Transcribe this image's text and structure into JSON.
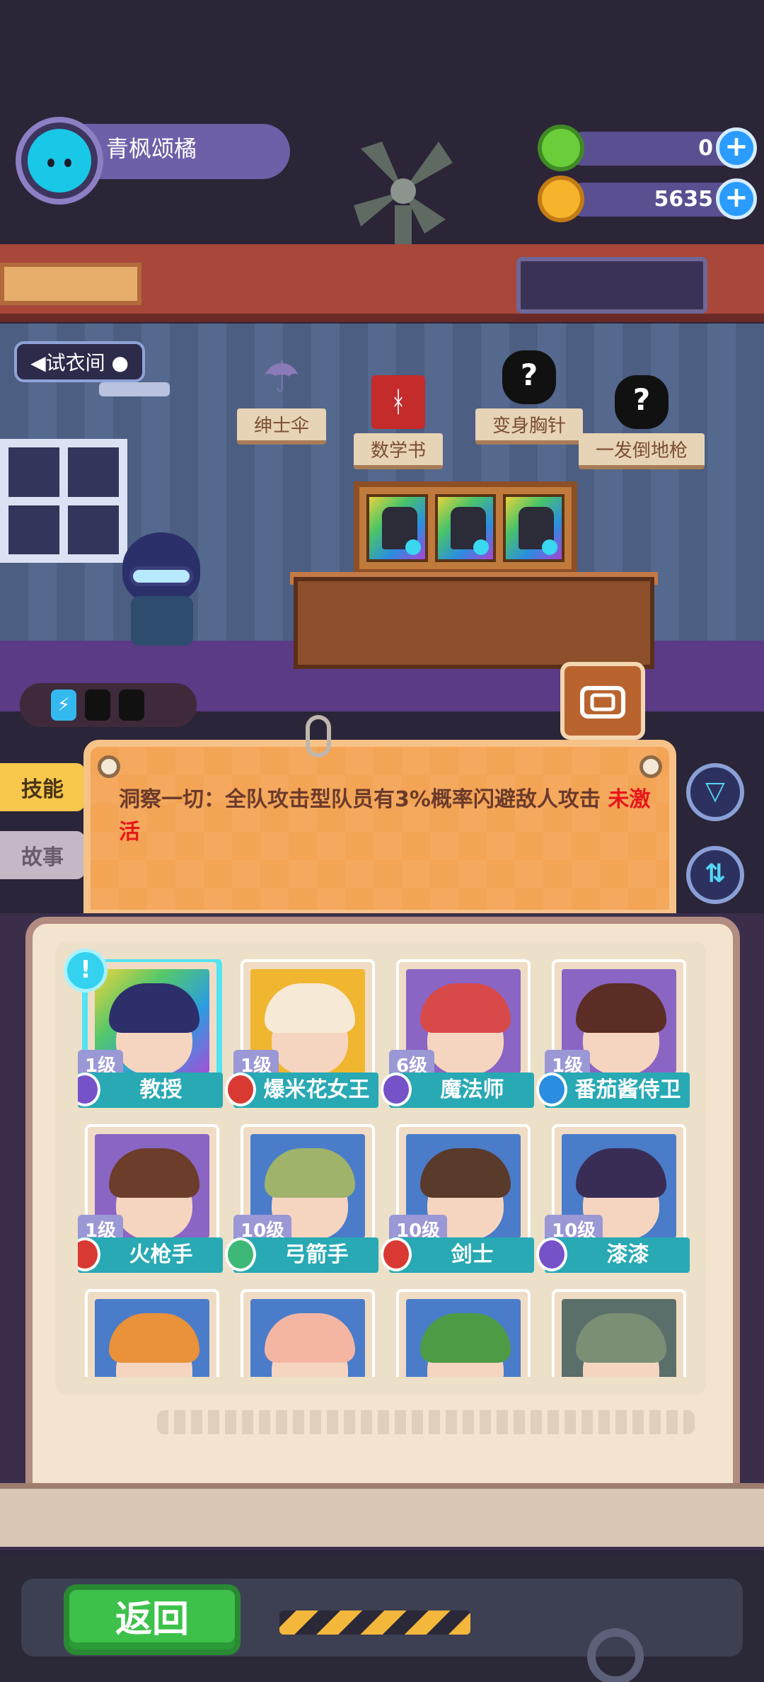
{
  "profile": {
    "name": "青枫颂橘"
  },
  "currencies": [
    {
      "value": "0",
      "icon": "green-gem-icon",
      "color": "#6ccd3a"
    },
    {
      "value": "5635",
      "icon": "gold-planet-coin-icon",
      "color": "#f5b42c"
    }
  ],
  "room": {
    "fitting_room_label": "◀试衣间 ●",
    "items": [
      {
        "label": "绅士伞",
        "icon": "umbrella-icon"
      },
      {
        "label": "数学书",
        "icon": "math-book-icon"
      },
      {
        "label": "变身胸针",
        "icon": "mystery-brooch-icon"
      },
      {
        "label": "一发倒地枪",
        "icon": "mystery-gun-icon"
      }
    ],
    "book_glyph": "ᚼ",
    "mystery_glyph": "?",
    "energy_glyph": "⚡"
  },
  "tabs": {
    "skill": "技能",
    "story": "故事"
  },
  "skill": {
    "text": "洞察一切：全队攻击型队员有3%概率闪避敌人攻击",
    "status": "未激活",
    "status_color": "#e6171b"
  },
  "buttons": {
    "filter": "▽",
    "sort": "⇅",
    "back": "返回",
    "plus": "+",
    "notice": "!"
  },
  "heroes": [
    {
      "level": "1级",
      "name": "教授",
      "faction": "purple",
      "bg": "rainbow",
      "hair": "#2d2f6b"
    },
    {
      "level": "1级",
      "name": "爆米花女王",
      "faction": "red",
      "bg": "#f1b630",
      "hair": "#f6ead6"
    },
    {
      "level": "6级",
      "name": "魔法师",
      "faction": "purple",
      "bg": "#8a65c4",
      "hair": "#d84a4a"
    },
    {
      "level": "1级",
      "name": "番茄酱侍卫",
      "faction": "blue",
      "bg": "#8a65c4",
      "hair": "#5b2d24"
    },
    {
      "level": "1级",
      "name": "火枪手",
      "faction": "red",
      "bg": "#8a65c4",
      "hair": "#6b3d2a"
    },
    {
      "level": "10级",
      "name": "弓箭手",
      "faction": "green",
      "bg": "#4a7cc9",
      "hair": "#9fb36a"
    },
    {
      "level": "10级",
      "name": "剑士",
      "faction": "red",
      "bg": "#4a7cc9",
      "hair": "#5a3a2a"
    },
    {
      "level": "10级",
      "name": "漆漆",
      "faction": "purple",
      "bg": "#4a7cc9",
      "hair": "#3a2d55"
    },
    {
      "level": "",
      "name": "",
      "faction": "",
      "bg": "#4a7cc9",
      "hair": "#e9923a"
    },
    {
      "level": "",
      "name": "",
      "faction": "",
      "bg": "#4a7cc9",
      "hair": "#f4b6a3"
    },
    {
      "level": "",
      "name": "",
      "faction": "",
      "bg": "#4a7cc9",
      "hair": "#4d9b45"
    },
    {
      "level": "",
      "name": "",
      "faction": "",
      "bg": "#5a6e6a",
      "hair": "#7a8f74"
    }
  ]
}
